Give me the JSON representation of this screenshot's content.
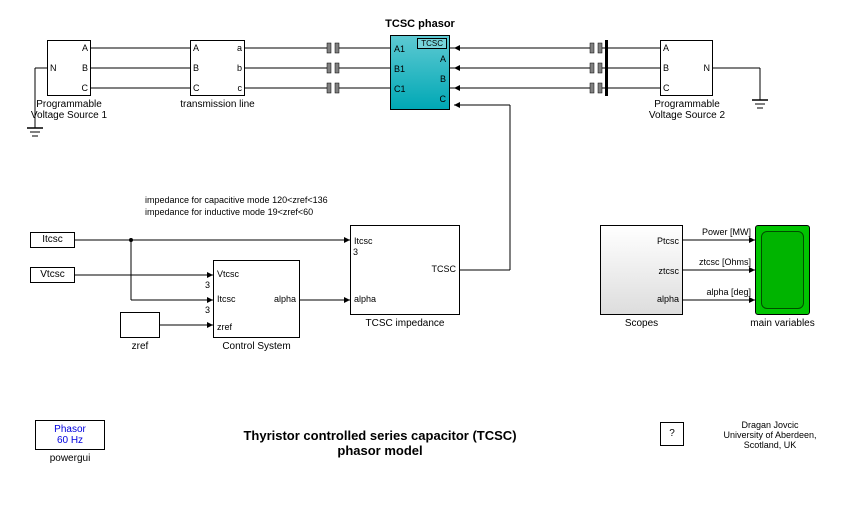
{
  "title_top": "TCSC phasor",
  "title_main": "Thyristor controlled series capacitor (TCSC) phasor model",
  "impedance_text1": "impedance for capacitive mode 120<zref<136",
  "impedance_text2": "impedance for inductive mode 19<zref<60",
  "blocks": {
    "pvs1": {
      "label": "Programmable\nVoltage Source 1",
      "pA": "A",
      "pB": "B",
      "pC": "C",
      "pN": "N"
    },
    "pvs2": {
      "label": "Programmable\nVoltage Source 2",
      "pA": "A",
      "pB": "B",
      "pC": "C",
      "pN": "N"
    },
    "tline": {
      "label": "transmission line",
      "pA": "A",
      "pB": "B",
      "pC": "C",
      "pa": "a",
      "pb": "b",
      "pc": "c"
    },
    "tcsc": {
      "label": "TCSC",
      "pA1": "A1",
      "pB1": "B1",
      "pC1": "C1",
      "pA": "A",
      "pB": "B",
      "pC": "C"
    },
    "itcsc": {
      "label": "Itcsc"
    },
    "vtcsc": {
      "label": "Vtcsc"
    },
    "zref": {
      "label": "zref"
    },
    "control": {
      "label": "Control System",
      "pVtcsc": "Vtcsc",
      "pItcsc": "Itcsc",
      "pzref": "zref",
      "pAlpha": "alpha",
      "n3": "3"
    },
    "tcscimp": {
      "label": "TCSC impedance",
      "pItcsc": "Itcsc",
      "palpha": "alpha",
      "pTCSC": "TCSC",
      "n3": "3"
    },
    "scopes": {
      "label": "Scopes",
      "pPtcsc": "Ptcsc",
      "pZtcsc": "ztcsc",
      "palpha": "alpha",
      "oPower": "Power [MW]",
      "oZtcsc": "ztcsc [Ohms]",
      "oAlpha": "alpha [deg]"
    },
    "mainvars": {
      "label": "main variables"
    }
  },
  "phasor": {
    "l1": "Phasor",
    "l2": "60 Hz",
    "label": "powergui"
  },
  "help": {
    "q": "?"
  },
  "credits": {
    "l1": "Dragan Jovcic",
    "l2": "University of Aberdeen,",
    "l3": "Scotland, UK"
  }
}
